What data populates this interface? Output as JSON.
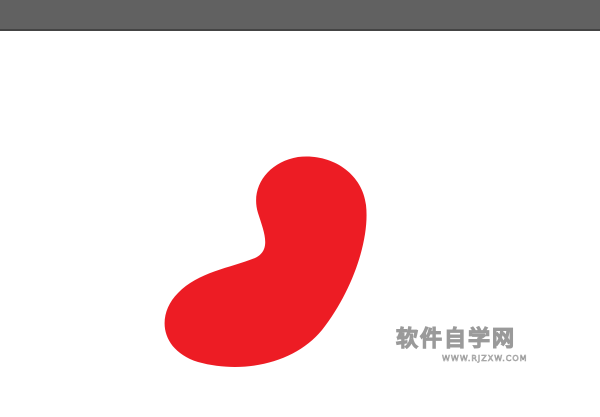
{
  "window": {
    "topbar_color": "#616161",
    "canvas_color": "#ffffff"
  },
  "shape": {
    "fill": "#ED1C24"
  },
  "watermark": {
    "title": "软件自学网",
    "subtitle": "WWW.RJZXW.COM"
  }
}
